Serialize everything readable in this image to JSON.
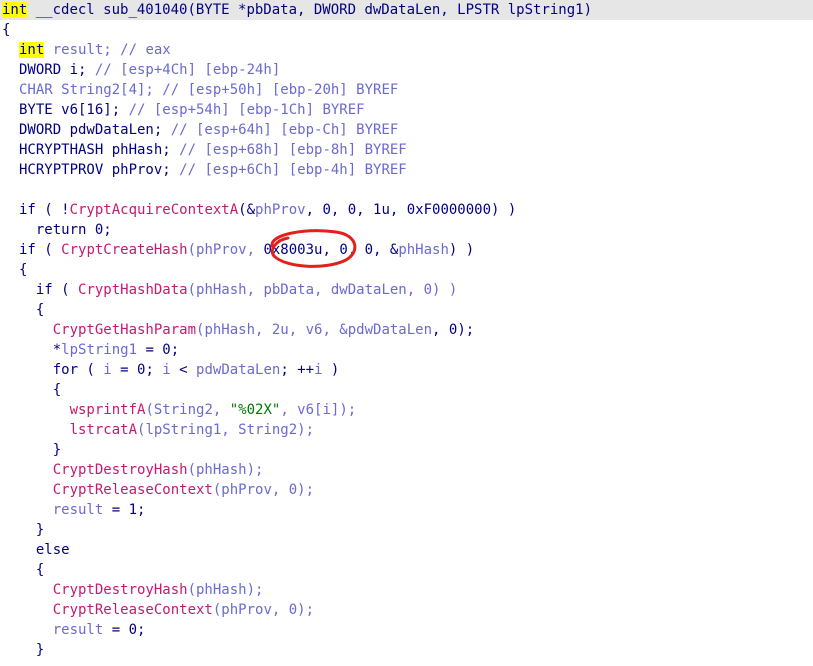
{
  "code": {
    "lines": [
      [
        {
          "t": "int",
          "c": "hl"
        },
        {
          "t": " __cdecl sub_401040(BYTE *pbData, DWORD dwDataLen, LPSTR lpString1)",
          "c": "kw"
        }
      ],
      [
        {
          "t": "{",
          "c": "pun"
        }
      ],
      [
        {
          "t": "int",
          "c": "hl"
        },
        {
          "t": " result; // eax",
          "c": "cm"
        }
      ],
      [
        {
          "t": "DWORD i; ",
          "c": "kw"
        },
        {
          "t": "// [esp+4Ch] [ebp-24h]",
          "c": "cm"
        }
      ],
      [
        {
          "t": "CHAR String2[4]; ",
          "c": "var"
        },
        {
          "t": "// [esp+50h] [ebp-20h] BYREF",
          "c": "cm"
        }
      ],
      [
        {
          "t": "BYTE v6[16]; ",
          "c": "kw"
        },
        {
          "t": "// [esp+54h] [ebp-1Ch] BYREF",
          "c": "cm"
        }
      ],
      [
        {
          "t": "DWORD pdwDataLen; ",
          "c": "kw"
        },
        {
          "t": "// [esp+64h] [ebp-Ch] BYREF",
          "c": "cm"
        }
      ],
      [
        {
          "t": "HCRYPTHASH phHash; ",
          "c": "kw"
        },
        {
          "t": "// [esp+68h] [ebp-8h] BYREF",
          "c": "cm"
        }
      ],
      [
        {
          "t": "HCRYPTPROV phProv; ",
          "c": "kw"
        },
        {
          "t": "// [esp+6Ch] [ebp-4h] BYREF",
          "c": "cm"
        }
      ],
      [],
      [
        {
          "t": "if ( !",
          "c": "kw"
        },
        {
          "t": "CryptAcquireContextA",
          "c": "fn"
        },
        {
          "t": "(&",
          "c": "kw"
        },
        {
          "t": "phProv",
          "c": "var"
        },
        {
          "t": ", 0, 0, 1u, 0xF0000000) )",
          "c": "kw"
        }
      ],
      [
        {
          "t": "  return 0;",
          "c": "kw"
        }
      ],
      [
        {
          "t": "if ( ",
          "c": "kw"
        },
        {
          "t": "CryptCreateHash",
          "c": "fn"
        },
        {
          "t": "(phProv, ",
          "c": "var"
        },
        {
          "t": "0x8003u",
          "c": "kw"
        },
        {
          "t": ", 0, 0, &",
          "c": "kw"
        },
        {
          "t": "phHash",
          "c": "var"
        },
        {
          "t": ") )",
          "c": "kw"
        }
      ],
      [
        {
          "t": "{",
          "c": "pun"
        }
      ],
      [
        {
          "t": "  if ( ",
          "c": "kw"
        },
        {
          "t": "CryptHashData",
          "c": "fn"
        },
        {
          "t": "(phHash, pbData, dwDataLen, 0) )",
          "c": "var"
        }
      ],
      [
        {
          "t": "  {",
          "c": "pun"
        }
      ],
      [
        {
          "t": "    ",
          "c": "kw"
        },
        {
          "t": "CryptGetHashParam",
          "c": "fn"
        },
        {
          "t": "(phHash, 2u, v6, &",
          "c": "var"
        },
        {
          "t": "pdwDataLen",
          "c": "var"
        },
        {
          "t": ", 0);",
          "c": "kw"
        }
      ],
      [
        {
          "t": "    *",
          "c": "kw"
        },
        {
          "t": "lpString1",
          "c": "var"
        },
        {
          "t": " = 0;",
          "c": "kw"
        }
      ],
      [
        {
          "t": "    for ( ",
          "c": "kw"
        },
        {
          "t": "i",
          "c": "var"
        },
        {
          "t": " = 0; ",
          "c": "kw"
        },
        {
          "t": "i",
          "c": "var"
        },
        {
          "t": " < ",
          "c": "kw"
        },
        {
          "t": "pdwDataLen",
          "c": "var"
        },
        {
          "t": "; ++",
          "c": "kw"
        },
        {
          "t": "i",
          "c": "var"
        },
        {
          "t": " )",
          "c": "kw"
        }
      ],
      [
        {
          "t": "    {",
          "c": "pun"
        }
      ],
      [
        {
          "t": "      ",
          "c": "kw"
        },
        {
          "t": "wsprintfA",
          "c": "fn"
        },
        {
          "t": "(String2, ",
          "c": "var"
        },
        {
          "t": "\"%02X\"",
          "c": "str"
        },
        {
          "t": ", v6[i]);",
          "c": "var"
        }
      ],
      [
        {
          "t": "      ",
          "c": "kw"
        },
        {
          "t": "lstrcatA",
          "c": "fn"
        },
        {
          "t": "(lpString1, String2);",
          "c": "var"
        }
      ],
      [
        {
          "t": "    }",
          "c": "pun"
        }
      ],
      [
        {
          "t": "    ",
          "c": "kw"
        },
        {
          "t": "CryptDestroyHash",
          "c": "fn"
        },
        {
          "t": "(phHash);",
          "c": "var"
        }
      ],
      [
        {
          "t": "    ",
          "c": "kw"
        },
        {
          "t": "CryptReleaseContext",
          "c": "fn"
        },
        {
          "t": "(phProv, 0);",
          "c": "var"
        }
      ],
      [
        {
          "t": "    ",
          "c": "kw"
        },
        {
          "t": "result",
          "c": "var"
        },
        {
          "t": " = 1;",
          "c": "kw"
        }
      ],
      [
        {
          "t": "  }",
          "c": "pun"
        }
      ],
      [
        {
          "t": "  else",
          "c": "kw"
        }
      ],
      [
        {
          "t": "  {",
          "c": "pun"
        }
      ],
      [
        {
          "t": "    ",
          "c": "kw"
        },
        {
          "t": "CryptDestroyHash",
          "c": "fn"
        },
        {
          "t": "(phHash);",
          "c": "var"
        }
      ],
      [
        {
          "t": "    ",
          "c": "kw"
        },
        {
          "t": "CryptReleaseContext",
          "c": "fn"
        },
        {
          "t": "(phProv, 0);",
          "c": "var"
        }
      ],
      [
        {
          "t": "    ",
          "c": "kw"
        },
        {
          "t": "result",
          "c": "var"
        },
        {
          "t": " = 0;",
          "c": "kw"
        }
      ],
      [
        {
          "t": "  }",
          "c": "pun"
        }
      ]
    ]
  },
  "colors": {
    "highlight": "#ffff00",
    "keyword": "#000080",
    "function": "#c41a71",
    "variable": "#6a6ad0",
    "string": "#007a00",
    "annotation": "#e3201b"
  }
}
